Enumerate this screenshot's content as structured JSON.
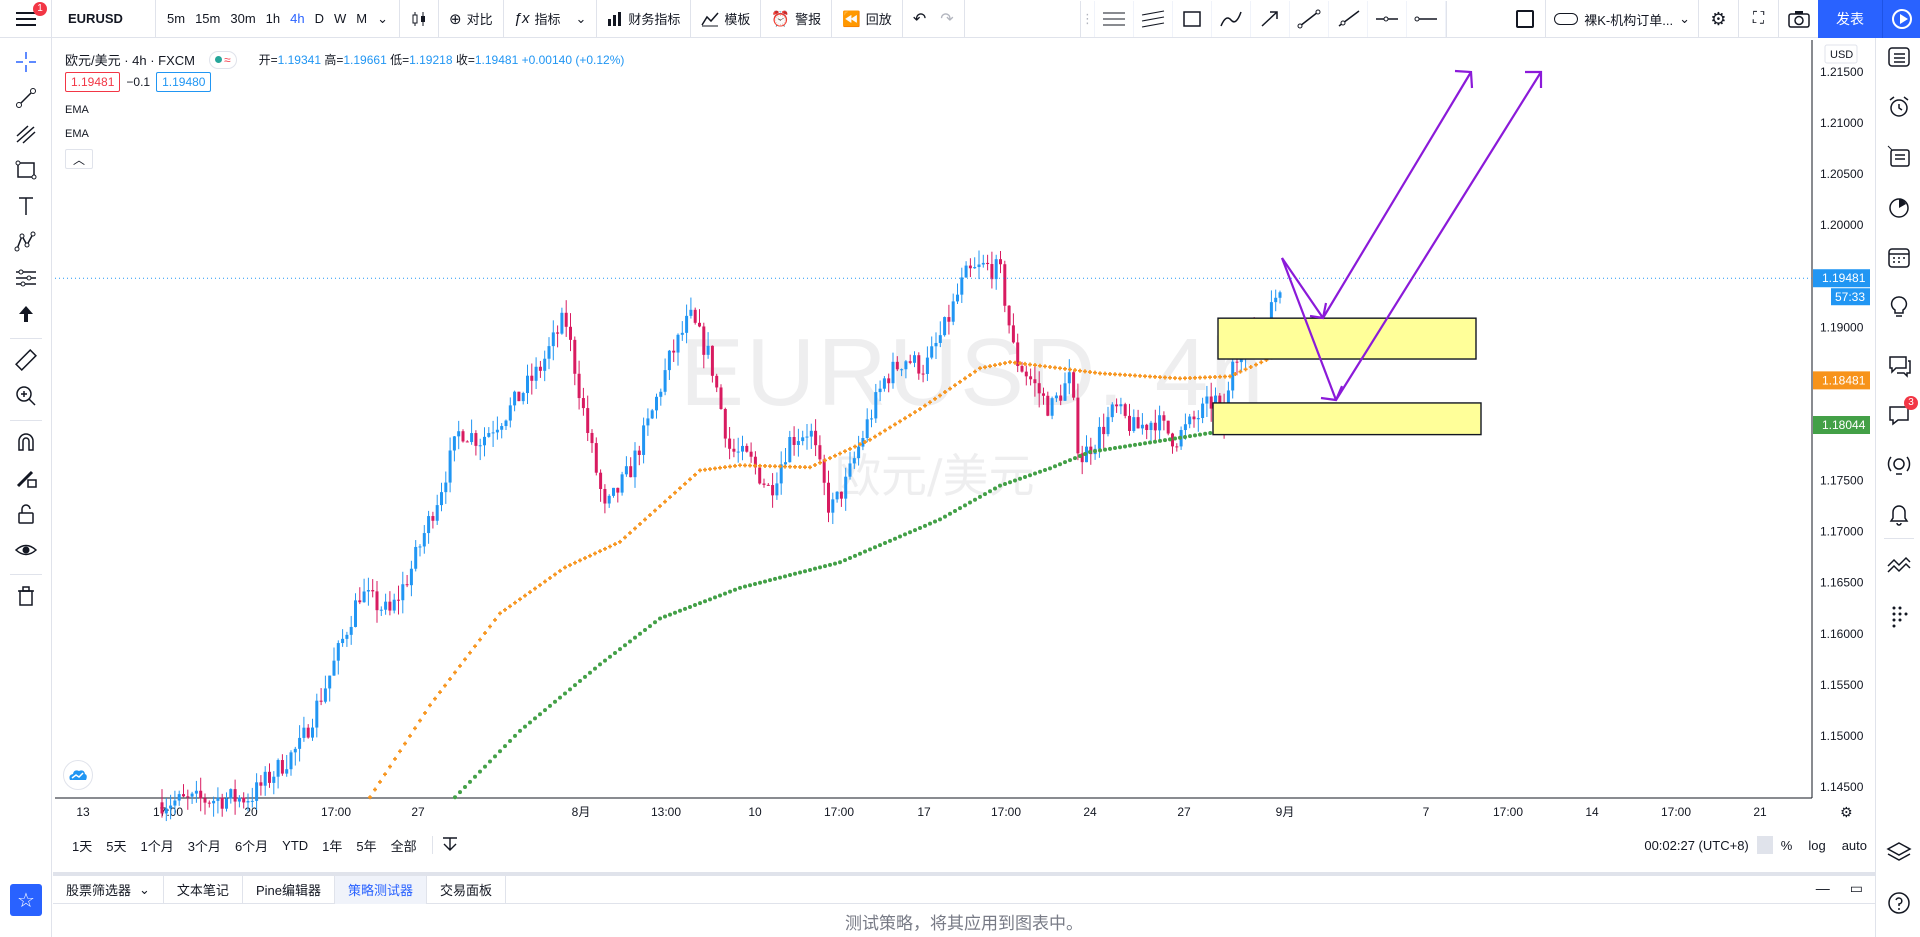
{
  "topbar": {
    "menu_badge": "1",
    "symbol": "EURUSD",
    "intervals": [
      "5m",
      "15m",
      "30m",
      "1h",
      "4h",
      "D",
      "W",
      "M"
    ],
    "active_interval": "4h",
    "compare_label": "对比",
    "indicators_label": "指标",
    "financials_label": "财务指标",
    "templates_label": "模板",
    "alert_label": "警报",
    "replay_label": "回放",
    "layout_template": "裸K-机构订单...",
    "publish_label": "发表"
  },
  "legend": {
    "title": "欧元/美元 · 4h · FXCM",
    "open_label": "开=",
    "open": "1.19341",
    "high_label": "高=",
    "high": "1.19661",
    "low_label": "低=",
    "low": "1.19218",
    "close_label": "收=",
    "close": "1.19481",
    "change": "+0.00140 (+0.12%)",
    "sell_price": "1.19481",
    "spread": "−0.1",
    "buy_price": "1.19480",
    "ind1": "EMA",
    "ind2": "EMA"
  },
  "watermark": {
    "symbol_line": "EURUSD, 4h",
    "name_line": "欧元/美元"
  },
  "price_axis": {
    "currency": "USD",
    "ticks": [
      "1.21500",
      "1.21000",
      "1.20500",
      "1.20000",
      "1.19500",
      "1.19000",
      "1.18500",
      "1.18000",
      "1.17500",
      "1.17000",
      "1.16500",
      "1.16000",
      "1.15500",
      "1.15000",
      "1.14500"
    ],
    "current_price": "1.19481",
    "countdown": "57:33",
    "ema1_price": "1.18481",
    "ema2_price": "1.18044"
  },
  "time_axis": {
    "ticks": [
      "13",
      "17:00",
      "20",
      "17:00",
      "27",
      "8月",
      "13:00",
      "10",
      "17:00",
      "17",
      "17:00",
      "24",
      "27",
      "9月",
      "7",
      "17:00",
      "14",
      "17:00",
      "21"
    ]
  },
  "rangebar": {
    "ranges": [
      "1天",
      "5天",
      "1个月",
      "3个月",
      "6个月",
      "YTD",
      "1年",
      "5年",
      "全部"
    ],
    "clock": "00:02:27 (UTC+8)",
    "percent": "%",
    "log": "log",
    "auto": "auto"
  },
  "bottom": {
    "tabs": [
      "股票筛选器",
      "文本笔记",
      "Pine编辑器",
      "策略测试器",
      "交易面板"
    ],
    "active_tab": "策略测试器",
    "message": "测试策略，将其应用到图表中。"
  },
  "right_sidebar": {
    "notif_badge": "3"
  },
  "colors": {
    "up": "#2196f3",
    "down": "#d81b60",
    "ema_fast": "#f7931a",
    "ema_slow": "#43a047",
    "zone_fill": "#ffff99",
    "arrow": "#8b1ad9",
    "accent": "#2962ff"
  },
  "chart_data": {
    "type": "candlestick",
    "symbol": "EURUSD",
    "timeframe": "4h",
    "ylim": [
      1.143,
      1.218
    ],
    "current_price": 1.19481,
    "ema_fast_last": 1.18481,
    "ema_slow_last": 1.18044,
    "zones": [
      {
        "from": 1.1869,
        "to": 1.1909
      },
      {
        "from": 1.1795,
        "to": 1.1826
      }
    ]
  }
}
